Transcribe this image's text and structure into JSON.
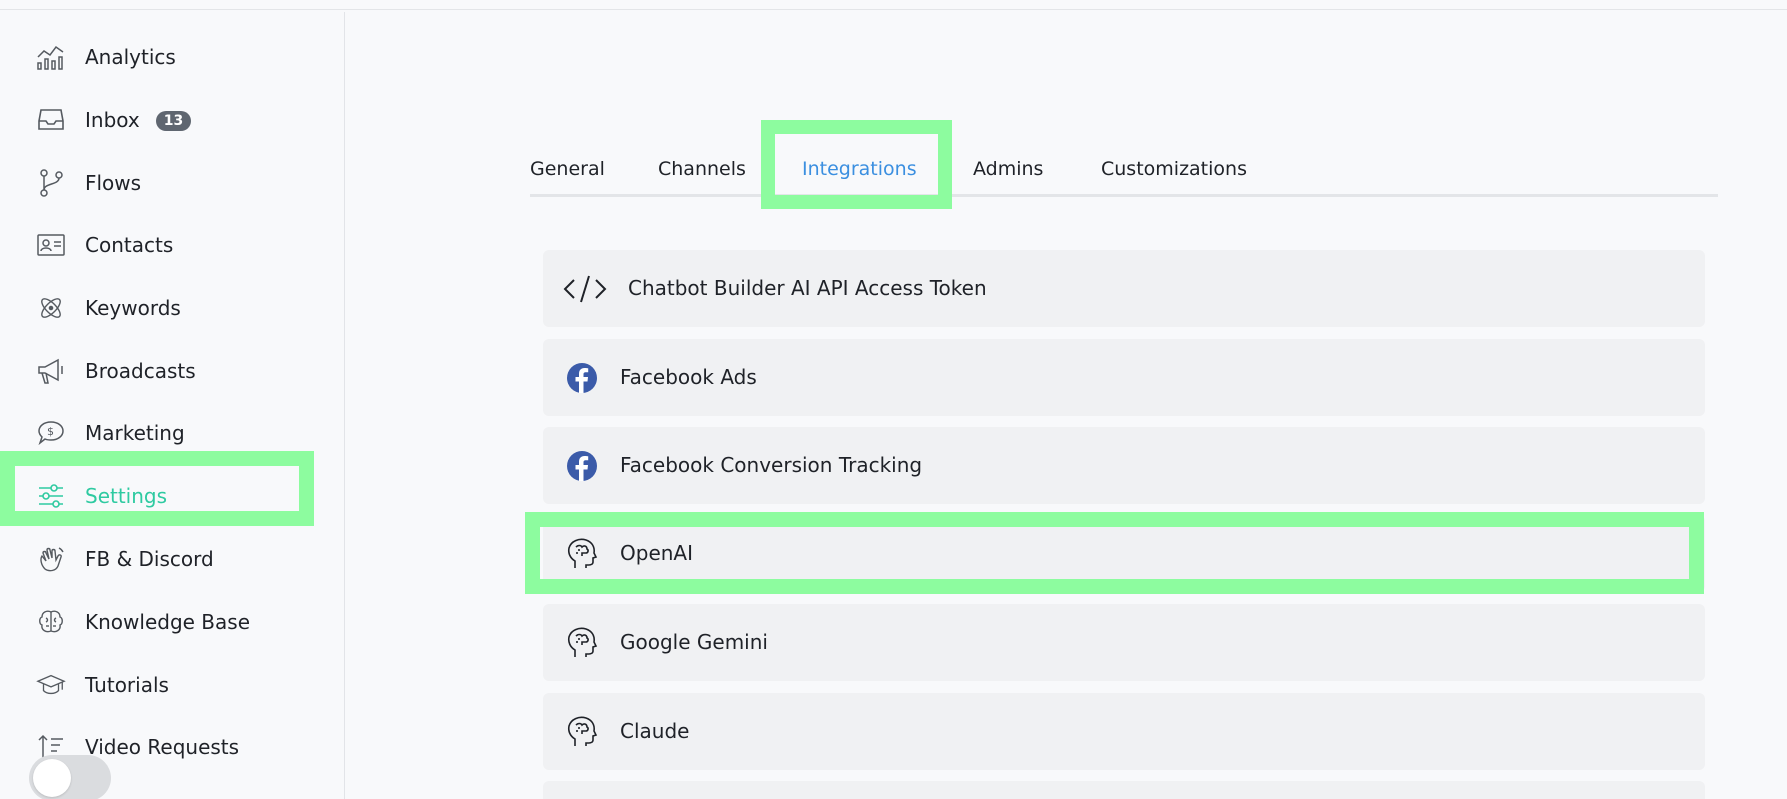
{
  "sidebar": {
    "items": [
      {
        "label": "Analytics",
        "icon": "analytics-icon"
      },
      {
        "label": "Inbox",
        "icon": "inbox-icon",
        "badge": "13"
      },
      {
        "label": "Flows",
        "icon": "flows-icon"
      },
      {
        "label": "Contacts",
        "icon": "contacts-icon"
      },
      {
        "label": "Keywords",
        "icon": "keywords-icon"
      },
      {
        "label": "Broadcasts",
        "icon": "megaphone-icon"
      },
      {
        "label": "Marketing",
        "icon": "dollar-chat-icon"
      },
      {
        "label": "Settings",
        "icon": "sliders-icon",
        "active": true
      },
      {
        "label": "FB & Discord",
        "icon": "hand-wave-icon"
      },
      {
        "label": "Knowledge Base",
        "icon": "brain-icon"
      },
      {
        "label": "Tutorials",
        "icon": "graduation-cap-icon"
      },
      {
        "label": "Video Requests",
        "icon": "sort-ascending-icon"
      }
    ]
  },
  "tabs": [
    {
      "label": "General"
    },
    {
      "label": "Channels"
    },
    {
      "label": "Integrations",
      "active": true
    },
    {
      "label": "Admins"
    },
    {
      "label": "Customizations"
    }
  ],
  "integrations": [
    {
      "label": "Chatbot Builder AI API Access Token",
      "icon": "code-icon"
    },
    {
      "label": "Facebook Ads",
      "icon": "facebook-icon"
    },
    {
      "label": "Facebook Conversion Tracking",
      "icon": "facebook-icon"
    },
    {
      "label": "OpenAI",
      "icon": "ai-head-icon"
    },
    {
      "label": "Google Gemini",
      "icon": "ai-head-icon"
    },
    {
      "label": "Claude",
      "icon": "ai-head-icon"
    }
  ],
  "colors": {
    "accent_active_nav": "#2ecaa1",
    "accent_active_tab": "#3b8fe0",
    "highlight": "#8dfc9f",
    "facebook_blue": "#3b5ba9"
  }
}
